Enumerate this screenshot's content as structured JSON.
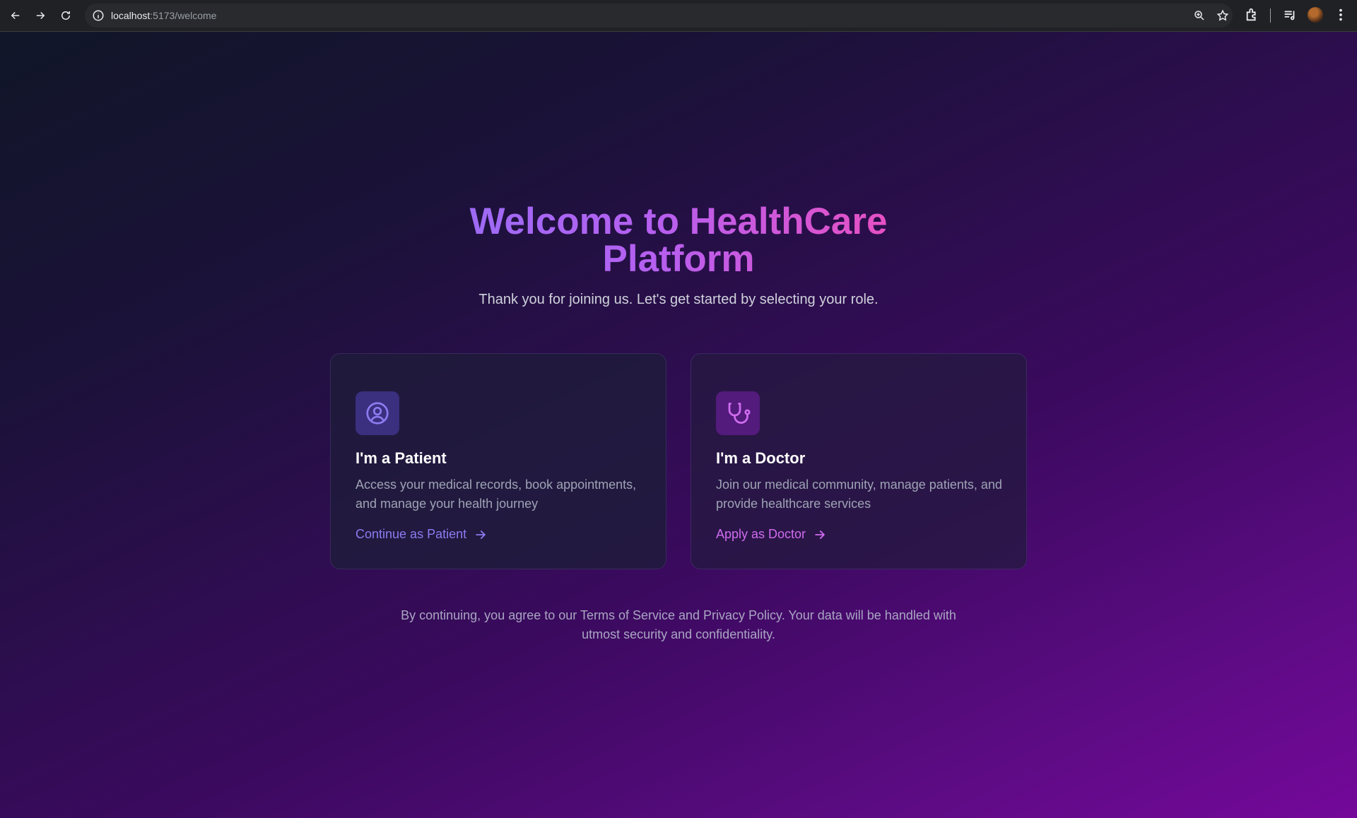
{
  "browser": {
    "url_host": "localhost",
    "url_rest": ":5173/welcome"
  },
  "hero": {
    "title": "Welcome to HealthCare Platform",
    "subtitle": "Thank you for joining us. Let's get started by selecting your role."
  },
  "cards": {
    "patient": {
      "icon": "user-circle-icon",
      "title": "I'm a Patient",
      "description": "Access your medical records, book appointments, and manage your health journey",
      "link": "Continue as Patient"
    },
    "doctor": {
      "icon": "stethoscope-icon",
      "title": "I'm a Doctor",
      "description": "Join our medical community, manage patients, and provide healthcare services",
      "link": "Apply as Doctor"
    }
  },
  "footer": {
    "note": "By continuing, you agree to our Terms of Service and Privacy Policy. Your data will be handled with utmost security and confidentiality."
  },
  "colors": {
    "patient_accent": "#8b7cf0",
    "doctor_accent": "#d06cf0",
    "title_gradient_start": "#9b6cf5",
    "title_gradient_end": "#ea4fc0"
  }
}
